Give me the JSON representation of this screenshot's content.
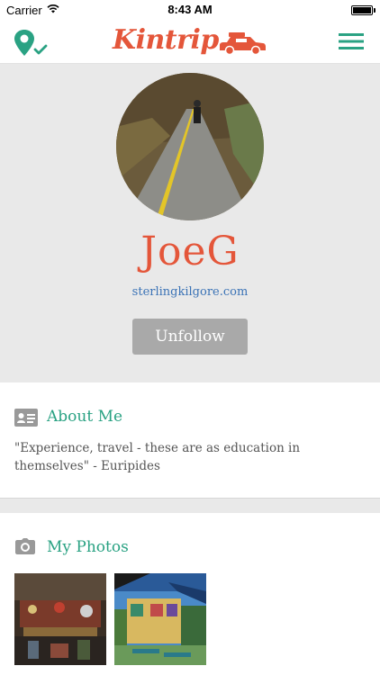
{
  "status_bar": {
    "carrier": "Carrier",
    "time": "8:43 AM"
  },
  "nav": {
    "logo_text": "Kintrip",
    "brand_color": "#e4563a",
    "accent_color": "#2aa283"
  },
  "profile": {
    "username": "JoeG",
    "website": "sterlingkilgore.com",
    "unfollow_label": "Unfollow"
  },
  "about": {
    "title": "About Me",
    "quote": "\"Experience, travel - these are as education in themselves\" - Euripides"
  },
  "photos": {
    "title": "My Photos"
  }
}
